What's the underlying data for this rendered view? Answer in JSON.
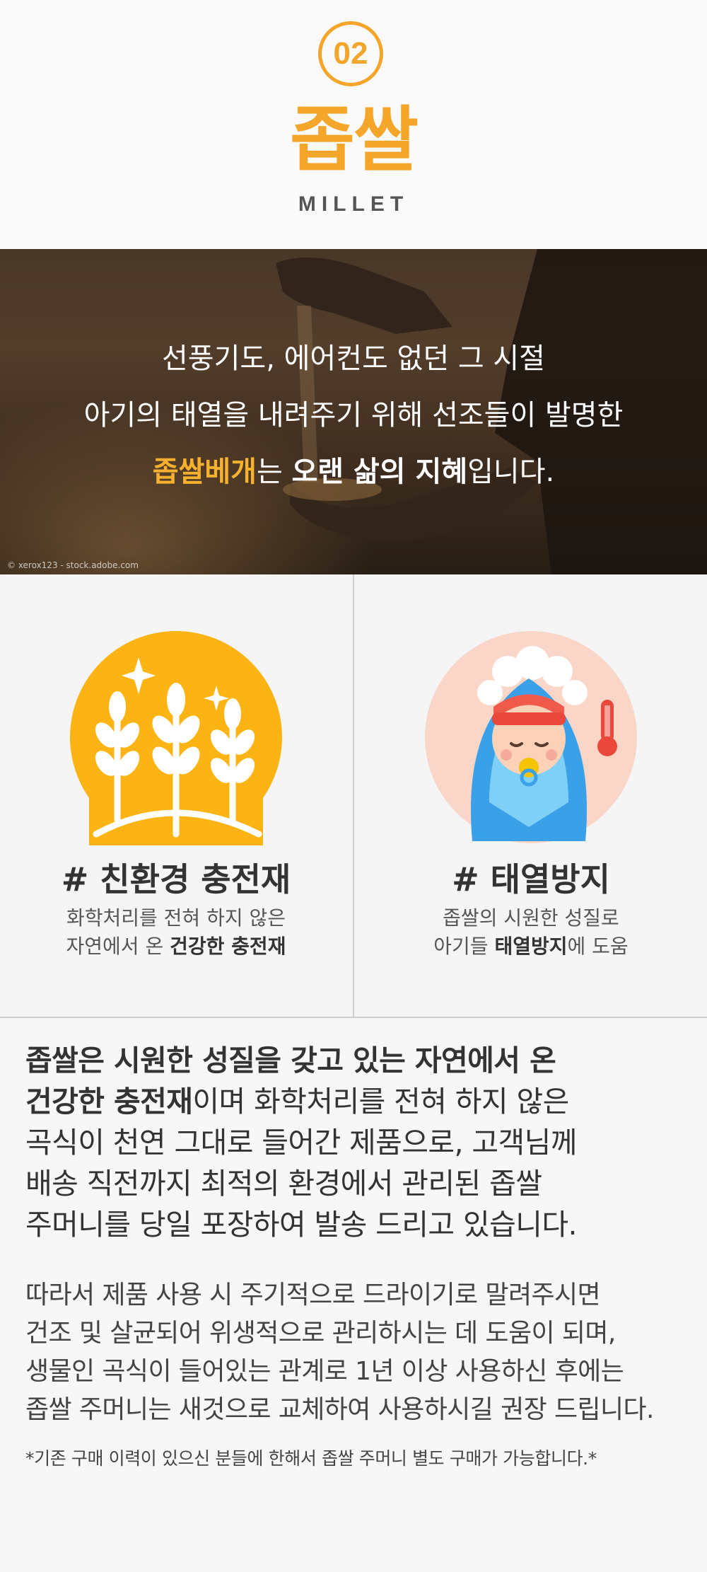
{
  "header": {
    "number": "02",
    "title": "좁쌀",
    "subtitle": "MILLET"
  },
  "hero": {
    "line1": "선풍기도, 에어컨도 없던 그 시절",
    "line2": "아기의 태열을 내려주기 위해 선조들이 발명한",
    "line3_highlight": "좁쌀베개",
    "line3_mid": "는 ",
    "line3_bold": "오랜 삶의 지혜",
    "line3_end": "입니다.",
    "credit": "© xerox123 - stock.adobe.com"
  },
  "features": [
    {
      "icon": "wheat-icon",
      "title": "# 친환경 충전재",
      "desc_line1": "화학처리를 전혀 하지 않은",
      "desc_line2_prefix": "자연에서 온 ",
      "desc_line2_bold": "건강한 충전재"
    },
    {
      "icon": "baby-thermometer-icon",
      "title": "# 태열방지",
      "desc_line1": "좁쌀의 시원한 성질로",
      "desc_line2_prefix": "아기들 ",
      "desc_line2_bold": "태열방지",
      "desc_line2_suffix": "에 도움"
    }
  ],
  "body": {
    "p1_bold_line1": "좁쌀은 시원한 성질을 갖고 있는 자연에서 온",
    "p1_bold_line2": "건강한 충전재",
    "p1_line2_rest": "이며 화학처리를 전혀 하지 않은",
    "p1_line3": "곡식이 천연 그대로 들어간 제품으로, 고객님께",
    "p1_line4": "배송 직전까지 최적의 환경에서 관리된 좁쌀",
    "p1_line5": "주머니를 당일 포장하여 발송 드리고 있습니다.",
    "p2_line1": "따라서 제품 사용 시 주기적으로 드라이기로 말려주시면",
    "p2_line2": "건조 및 살균되어 위생적으로 관리하시는 데 도움이 되며,",
    "p2_line3": "생물인 곡식이 들어있는 관계로 1년 이상 사용하신 후에는",
    "p2_line4": "좁쌀 주머니는 새것으로 교체하여 사용하시길 권장 드립니다.",
    "note": "*기존 구매 이력이 있으신 분들에 한해서 좁쌀 주머니 별도 구매가 가능합니다.*"
  },
  "colors": {
    "accent": "#f4a62a",
    "text": "#333333",
    "baby_blue": "#3aa0e8",
    "peach": "#f9d3c4"
  }
}
